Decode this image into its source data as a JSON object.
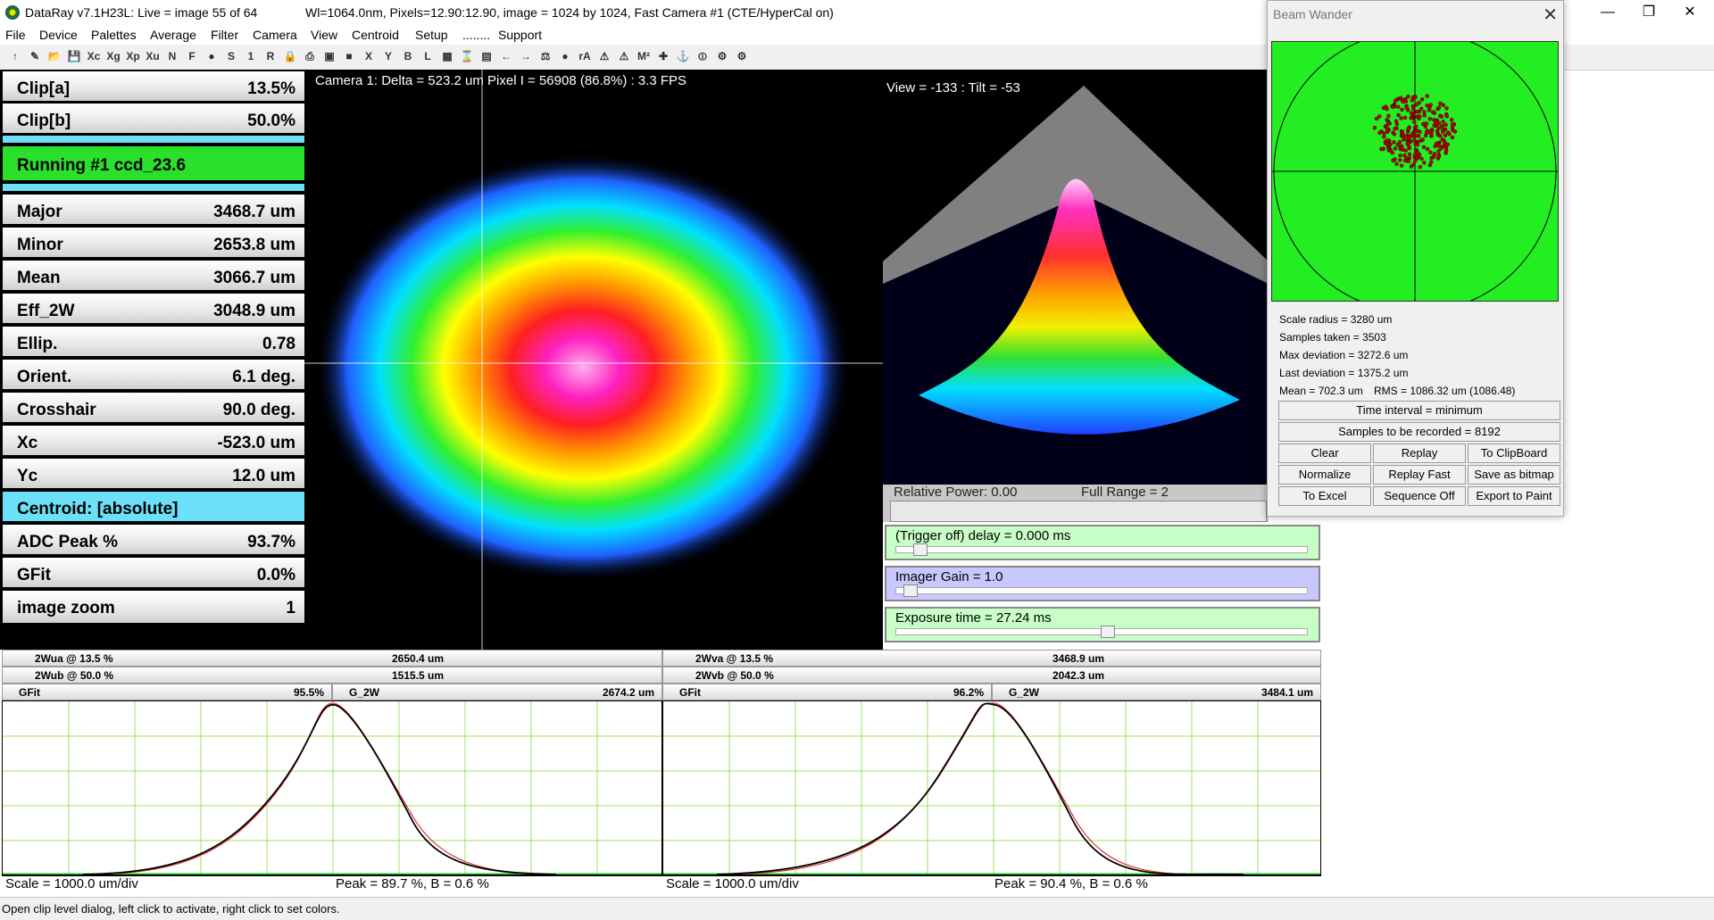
{
  "titlebar": {
    "app_title": "DataRay v7.1H23L: Live = image 55 of 64",
    "status": "Wl=1064.0nm, Pixels=12.90:12.90, image = 1024 by 1024, Fast   Camera #1  (CTE/HyperCal on)",
    "minimize": "—",
    "restore": "❐",
    "close": "✕"
  },
  "menu": [
    "File",
    "Device",
    "Palettes",
    "Average",
    "Filter",
    "Camera",
    "View",
    "Centroid",
    "Setup",
    "........",
    "Support"
  ],
  "toolbar": [
    "↑",
    "✎",
    "📂",
    "💾",
    "Xc",
    "Xg",
    "Xp",
    "Xu",
    "N",
    "F",
    "●",
    "S",
    "1",
    "R",
    "🔒",
    "⎙",
    "▣",
    "■",
    "X",
    "Y",
    "B",
    "L",
    "▦",
    "⌛",
    "▤",
    "←",
    "→",
    "⚖",
    "●",
    "rA",
    "⚠",
    "⚠",
    "M²",
    "✚",
    "⚓",
    "⏼",
    "⚙",
    "⚙"
  ],
  "params": {
    "clip_a": {
      "label": "Clip[a]",
      "value": "13.5%"
    },
    "clip_b": {
      "label": "Clip[b]",
      "value": "50.0%"
    },
    "running": "Running #1 ccd_23.6",
    "major": {
      "label": "Major",
      "value": "3468.7 um"
    },
    "minor": {
      "label": "Minor",
      "value": "2653.8 um"
    },
    "mean": {
      "label": "Mean",
      "value": "3066.7 um"
    },
    "eff2w": {
      "label": "Eff_2W",
      "value": "3048.9 um"
    },
    "ellip": {
      "label": "Ellip.",
      "value": "0.78"
    },
    "orient": {
      "label": "Orient.",
      "value": "6.1 deg."
    },
    "crosshair": {
      "label": "Crosshair",
      "value": "90.0 deg."
    },
    "xc": {
      "label": "Xc",
      "value": "-523.0 um"
    },
    "yc": {
      "label": "Yc",
      "value": "12.0 um"
    },
    "centroid": "Centroid: [absolute]",
    "adc_peak": {
      "label": "ADC Peak %",
      "value": "93.7%"
    },
    "gfit": {
      "label": "GFit",
      "value": "0.0%"
    },
    "zoom": {
      "label": "image zoom",
      "value": "1"
    }
  },
  "beamview": {
    "caption": "Camera 1: Delta = 523.2 um Pixel I = 56908 (86.8%) :  3.3 FPS"
  },
  "view3d": {
    "caption": "View = -133 : Tilt = -53"
  },
  "relpower": {
    "label": "Relative Power: 0.00",
    "range": "Full Range = 2"
  },
  "sliders": {
    "trigger": "(Trigger off) delay = 0.000 ms",
    "gain": "Imager Gain = 1.0",
    "exposure": "Exposure time = 27.24 ms",
    "gain_level": 0.02,
    "exposure_level": 0.5
  },
  "profiles": {
    "left": {
      "wa_label": "2Wua @ 13.5 %",
      "wa_value": "2650.4 um",
      "wb_label": "2Wub @ 50.0 %",
      "wb_value": "1515.5 um",
      "gfit_label": "GFit",
      "gfit_value": "95.5%",
      "g2w_label": "G_2W",
      "g2w_value": "2674.2 um",
      "scale": "Scale = 1000.0 um/div",
      "peak": "Peak = 89.7 %,  B = 0.6 %"
    },
    "right": {
      "wa_label": "2Wva @ 13.5 %",
      "wa_value": "3468.9 um",
      "wb_label": "2Wvb @ 50.0 %",
      "wb_value": "2042.3 um",
      "gfit_label": "GFit",
      "gfit_value": "96.2%",
      "g2w_label": "G_2W",
      "g2w_value": "3484.1 um",
      "scale": "Scale = 1000.0 um/div",
      "peak": "Peak = 90.4 %,  B = 0.6 %"
    }
  },
  "wander": {
    "title": "Beam Wander",
    "close": "✕",
    "scale_radius": "Scale radius = 3280 um",
    "samples_taken": "Samples taken = 3503",
    "max_dev": "Max deviation = 3272.6 um",
    "last_dev": "Last deviation = 1375.2 um",
    "mean": "Mean = 702.3 um",
    "rms": "RMS = 1086.32 um  (1086.48)",
    "time_interval": "Time interval = minimum",
    "samples_record": "Samples to be recorded = 8192",
    "btn_clear": "Clear",
    "btn_replay": "Replay",
    "btn_clip": "To ClipBoard",
    "btn_norm": "Normalize",
    "btn_replayfast": "Replay Fast",
    "btn_bitmap": "Save as bitmap",
    "btn_excel": "To Excel",
    "btn_seq": "Sequence Off",
    "btn_paint": "Export to Paint"
  },
  "statusbar": {
    "message": "Open clip level dialog, left click to activate, right click to set colors."
  },
  "colors": {
    "green": "#2be02b",
    "cyan": "#6ce0f8",
    "plot_grid": "#9ee060",
    "wander_bg": "#22ee22"
  }
}
